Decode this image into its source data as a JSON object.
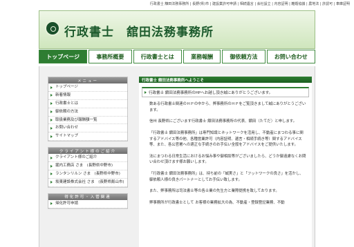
{
  "top_links": "行政書士 舘田法務事務所 | 長野(県)市 | 建設業許可申請 | 相続遺言 | 会社設立 | 内容証明 | 離婚協議 | 農地法 | 許認可 | 車庫証明",
  "site": {
    "title": "行政書士　舘田法務事務所"
  },
  "nav": [
    {
      "label": "トップページ",
      "active": true
    },
    {
      "label": "事務所概要"
    },
    {
      "label": "行政書士とは"
    },
    {
      "label": "業務報酬"
    },
    {
      "label": "御依頼方法"
    },
    {
      "label": "お問い合わせ"
    }
  ],
  "sidebar": {
    "menu": {
      "heading": "メニュー",
      "items": [
        "トップページ",
        "新着情報",
        "行政書士とは",
        "御依頼の方法",
        "取扱業務及び報酬額一覧",
        "お問い合わせ",
        "サイトマップ"
      ]
    },
    "clients": {
      "heading": "クライアント様のご紹介",
      "items": [
        "クライアント様のご紹介",
        "堀内工務店 さま　(長野県中野市)",
        "ランタンリルン さま　(長野県中野市)",
        "坂東建設株式会社 さま　(長野県飯山市)"
      ]
    },
    "permits": {
      "heading": "得化許可・入管関連",
      "items": [
        "帰化許可申請"
      ]
    }
  },
  "main": {
    "greeting": "行政書士 舘田法務事務所へようこそ",
    "tagline": "行政書士 舘田法務事務所のHPへお越し頂き誠にありがとうございます。",
    "paragraphs": [
      "数ある行政書士関連のＨＰの中から、弊事務所のＨＰをご覧頂きまして誠にありがとうございます。",
      "信州 長野県にございます行政書士 舘田法務事務所の代表、舘田（たてだ）と申します。",
      "「行政書士 舘田法務事務所」は専門知識とネットワークを活用し、不動産にまつわる事に関するアドバイス等の他、各種営業許可（内容証明、遺言・相続手続き等）関するアドバイス等、また、各公官署への適正な手続きのお手伝い全般をアドバイスをご提供いたします。",
      "法にまつわる日常生活におけるお悩み事や御相談等がございましたら、どうか御遠慮なくお問い合わせ頂けます様お願いします。",
      "「行政書士 舘田法務事務所」は、持ち前の「誠実さ」と「フットワークの良さ」を活かし、御依頼人様の良きパートナーとしてお手伝い致します。",
      "また、弊事務所は司法書士等の各士業の先生方と業際提携を致しております。",
      "弊事務所が行政書士として お客様の業務拡大の為、不動産・登録登記業務、不動"
    ]
  }
}
